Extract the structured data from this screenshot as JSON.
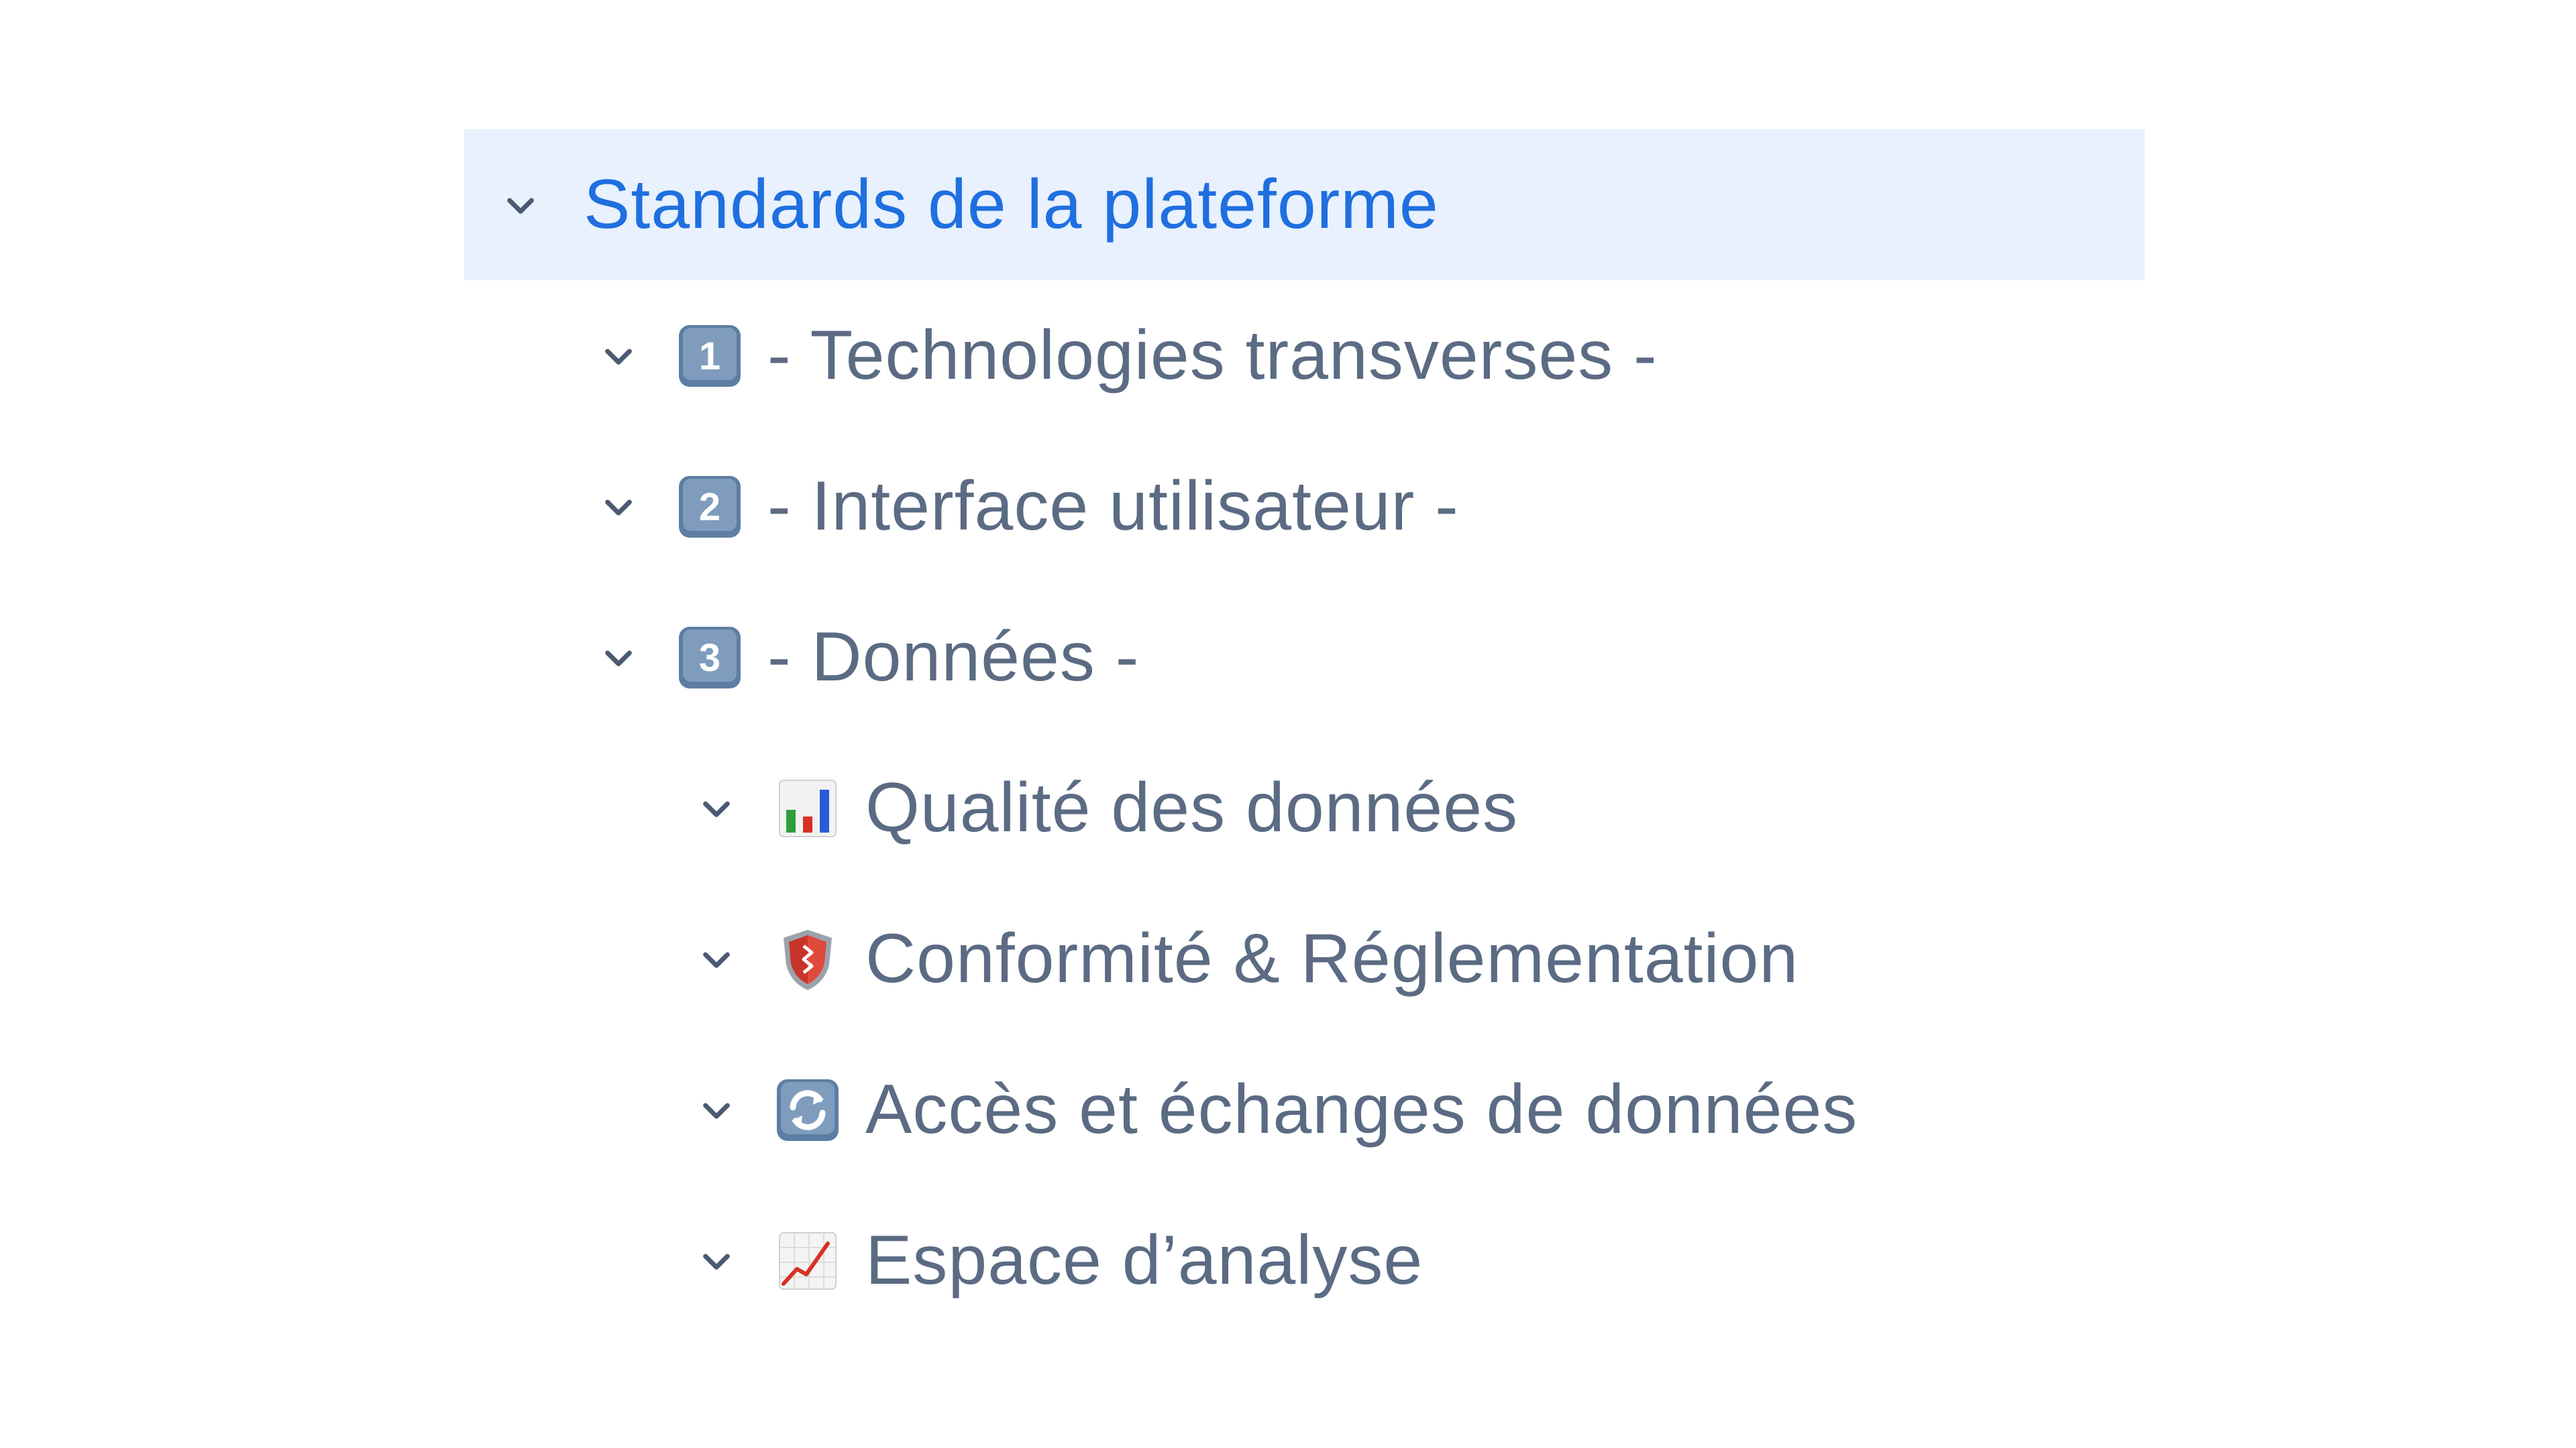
{
  "tree": {
    "root": {
      "label": "Standards de la plateforme",
      "icon": "chevron-down-icon",
      "selected": true
    },
    "sections": [
      {
        "badge": "1",
        "label": "- Technologies transverses -",
        "icon": "keycap-1-icon"
      },
      {
        "badge": "2",
        "label": "- Interface utilisateur -",
        "icon": "keycap-2-icon"
      },
      {
        "badge": "3",
        "label": "- Données -",
        "icon": "keycap-3-icon"
      }
    ],
    "subsections": [
      {
        "label": "Qualité des données",
        "icon": "bar-chart-icon"
      },
      {
        "label": "Conformité & Réglementation",
        "icon": "shield-icon"
      },
      {
        "label": "Accès et échanges de données",
        "icon": "arrows-cycle-icon"
      },
      {
        "label": "Espace d’analyse",
        "icon": "chart-increasing-icon"
      }
    ]
  },
  "colors": {
    "selected_bg": "#e8f1fd",
    "selected_text": "#1f6fe0",
    "text": "#5b6b83",
    "chevron": "#4a5a72"
  }
}
